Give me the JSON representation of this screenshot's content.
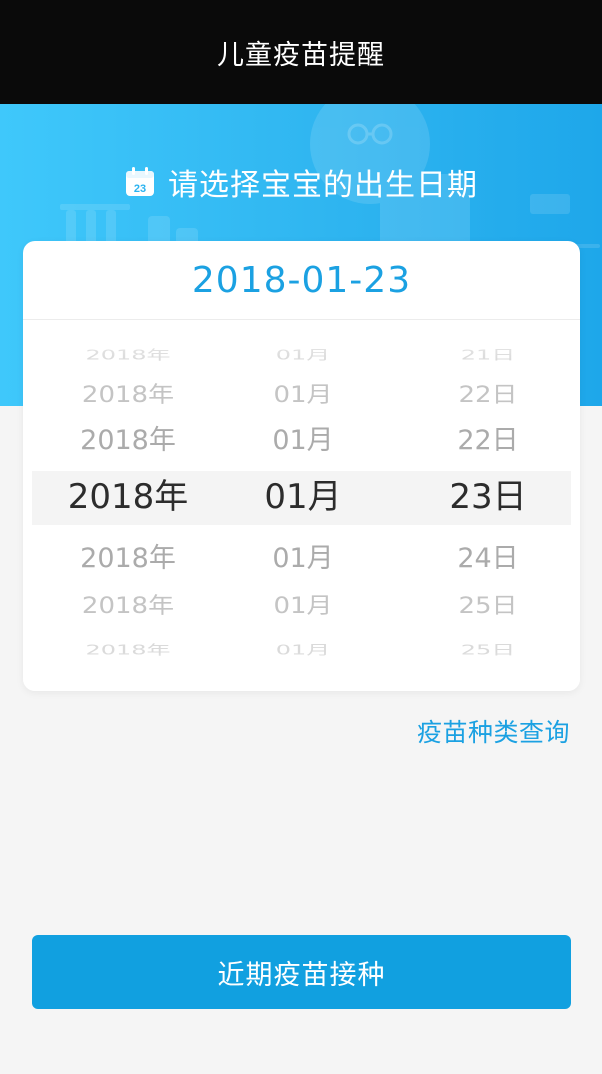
{
  "app": {
    "title": "儿童疫苗提醒"
  },
  "hero": {
    "title": "请选择宝宝的出生日期",
    "icon": "calendar-icon",
    "calendar_icon_day": "23"
  },
  "picker": {
    "selected_date": "2018-01-23",
    "years": [
      "2018年",
      "2018年",
      "2018年",
      "2018年",
      "2018年",
      "2018年",
      "2018年"
    ],
    "months": [
      "01月",
      "01月",
      "01月",
      "01月",
      "01月",
      "01月",
      "01月"
    ],
    "days": [
      "21日",
      "22日",
      "22日",
      "23日",
      "24日",
      "25日",
      "25日"
    ]
  },
  "links": {
    "vaccine_types": "疫苗种类查询"
  },
  "actions": {
    "recent_vaccination": "近期疫苗接种"
  },
  "colors": {
    "accent": "#1ba1e2",
    "button": "#11a0e0",
    "topbar": "#0a0a0a",
    "hero_gradient_start": "#3fc8fb",
    "hero_gradient_end": "#1ea7ea"
  }
}
